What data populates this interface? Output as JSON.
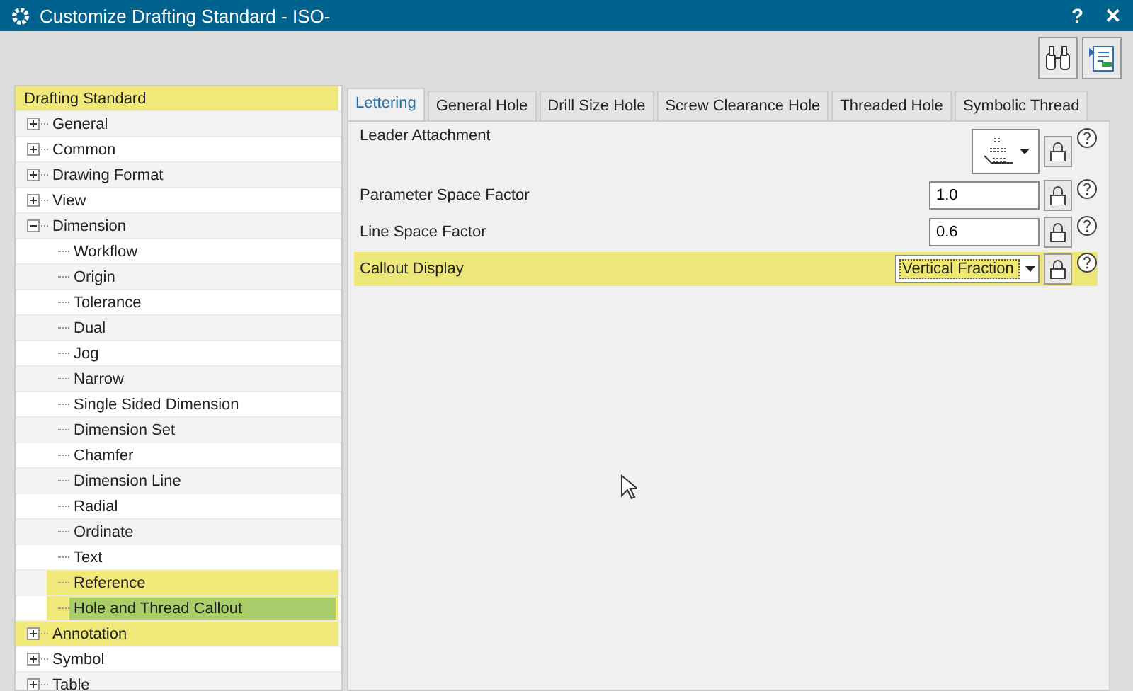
{
  "window": {
    "title": "Customize Drafting Standard - ISO-",
    "help": "?",
    "close": "✕"
  },
  "tree": {
    "items": [
      {
        "label": "Drafting Standard",
        "highlighted": true,
        "selected": false,
        "children": [
          {
            "label": "General",
            "expanded": false,
            "highlighted": false,
            "selected": false
          },
          {
            "label": "Common",
            "expanded": false,
            "highlighted": false,
            "selected": false
          },
          {
            "label": "Drawing Format",
            "expanded": false,
            "highlighted": false,
            "selected": false
          },
          {
            "label": "View",
            "expanded": false,
            "highlighted": false,
            "selected": false
          },
          {
            "label": "Dimension",
            "expanded": true,
            "highlighted": false,
            "selected": false,
            "children": [
              {
                "label": "Workflow",
                "highlighted": false,
                "selected": false
              },
              {
                "label": "Origin",
                "highlighted": false,
                "selected": false
              },
              {
                "label": "Tolerance",
                "highlighted": false,
                "selected": false
              },
              {
                "label": "Dual",
                "highlighted": false,
                "selected": false
              },
              {
                "label": "Jog",
                "highlighted": false,
                "selected": false
              },
              {
                "label": "Narrow",
                "highlighted": false,
                "selected": false
              },
              {
                "label": "Single Sided Dimension",
                "highlighted": false,
                "selected": false
              },
              {
                "label": "Dimension Set",
                "highlighted": false,
                "selected": false
              },
              {
                "label": "Chamfer",
                "highlighted": false,
                "selected": false
              },
              {
                "label": "Dimension Line",
                "highlighted": false,
                "selected": false
              },
              {
                "label": "Radial",
                "highlighted": false,
                "selected": false
              },
              {
                "label": "Ordinate",
                "highlighted": false,
                "selected": false
              },
              {
                "label": "Text",
                "highlighted": false,
                "selected": false
              },
              {
                "label": "Reference",
                "highlighted": true,
                "selected": false
              },
              {
                "label": "Hole and Thread Callout",
                "highlighted": true,
                "selected": true
              }
            ]
          },
          {
            "label": "Annotation",
            "expanded": false,
            "highlighted": true,
            "selected": false
          },
          {
            "label": "Symbol",
            "expanded": false,
            "highlighted": false,
            "selected": false
          },
          {
            "label": "Table",
            "expanded": false,
            "highlighted": false,
            "selected": false
          }
        ]
      }
    ]
  },
  "tabs": [
    {
      "label": "Lettering",
      "selected": true
    },
    {
      "label": "General Hole",
      "selected": false
    },
    {
      "label": "Drill Size Hole",
      "selected": false
    },
    {
      "label": "Screw Clearance Hole",
      "selected": false
    },
    {
      "label": "Threaded Hole",
      "selected": false
    },
    {
      "label": "Symbolic Thread",
      "selected": false
    }
  ],
  "properties": [
    {
      "label": "Leader Attachment",
      "kind": "symbol",
      "highlighted": false
    },
    {
      "label": "Parameter Space Factor",
      "kind": "number",
      "value": "1.0",
      "highlighted": false
    },
    {
      "label": "Line Space Factor",
      "kind": "number",
      "value": "0.6",
      "highlighted": false
    },
    {
      "label": "Callout Display",
      "kind": "dropdown",
      "value": "Vertical Fraction",
      "highlighted": true
    }
  ]
}
